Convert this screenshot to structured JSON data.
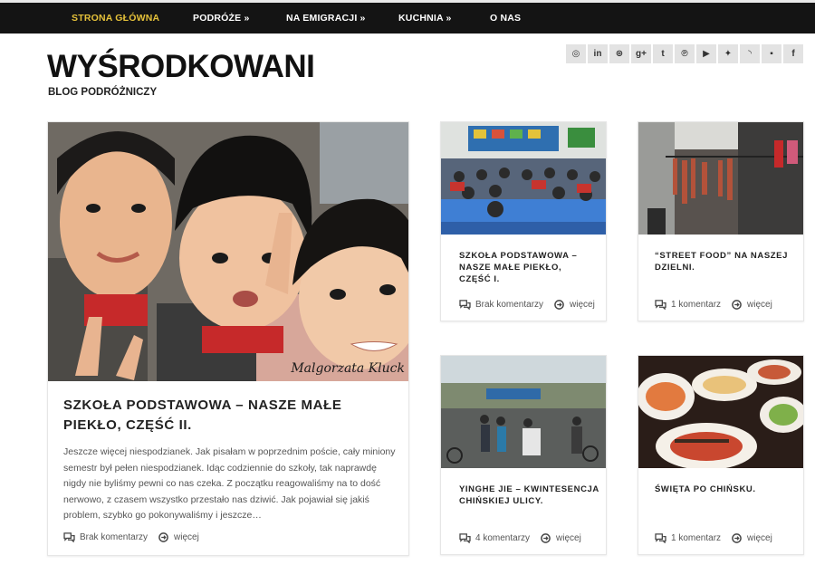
{
  "nav": {
    "items": [
      "STRONA GŁÓWNA",
      "PODRÓŻE »",
      "NA EMIGRACJI »",
      "KUCHNIA »",
      "O NAS"
    ]
  },
  "site": {
    "title": "WYŚRODKOWANI",
    "subtitle": "BLOG PODRÓŻNICZY"
  },
  "social": [
    "instagram-icon",
    "linkedin-icon",
    "dribbble-icon",
    "google-plus-icon",
    "tumblr-icon",
    "pinterest-icon",
    "youtube-icon",
    "twitter-icon",
    "rss-icon",
    "flickr-icon",
    "facebook-icon"
  ],
  "social_glyphs": [
    "◎",
    "in",
    "⊛",
    "g+",
    "t",
    "℗",
    "▶",
    "✦",
    "◝",
    "▪",
    "f"
  ],
  "posts": {
    "featured": {
      "title": "SZKOŁA PODSTAWOWA – NASZE MAŁE PIEKŁO, CZĘŚĆ II.",
      "excerpt": "Jeszcze więcej niespodzianek. Jak pisałam w poprzednim poście, cały miniony semestr był pełen niespodzianek. Idąc codziennie do szkoły, tak naprawdę nigdy nie byliśmy pewni co nas czeka. Z początku reagowaliśmy na to dość nerwowo, z czasem wszystko przestało nas dziwić. Jak pojawiał się jakiś problem, szybko go pokonywaliśmy i jeszcze…",
      "comments": "Brak komentarzy",
      "more": "więcej",
      "watermark": "Malgorzata Kluck"
    },
    "p1": {
      "title": "SZKOŁA PODSTAWOWA – NASZE MAŁE PIEKŁO, CZĘŚĆ I.",
      "comments": "Brak komentarzy",
      "more": "więcej"
    },
    "p2": {
      "title": "“STREET FOOD” NA NASZEJ DZIELNI.",
      "comments": "1 komentarz",
      "more": "więcej"
    },
    "p3": {
      "title": "YINGHE JIE – KWINTESENCJA CHIŃSKIEJ ULICY.",
      "comments": "4 komentarzy",
      "more": "więcej"
    },
    "p4": {
      "title": "ŚWIĘTA PO CHIŃSKU.",
      "comments": "1 komentarz",
      "more": "więcej"
    }
  },
  "colors": {
    "nav_bg": "#141414",
    "nav_active": "#e6c23a",
    "social_bg": "#e3e3e3"
  }
}
